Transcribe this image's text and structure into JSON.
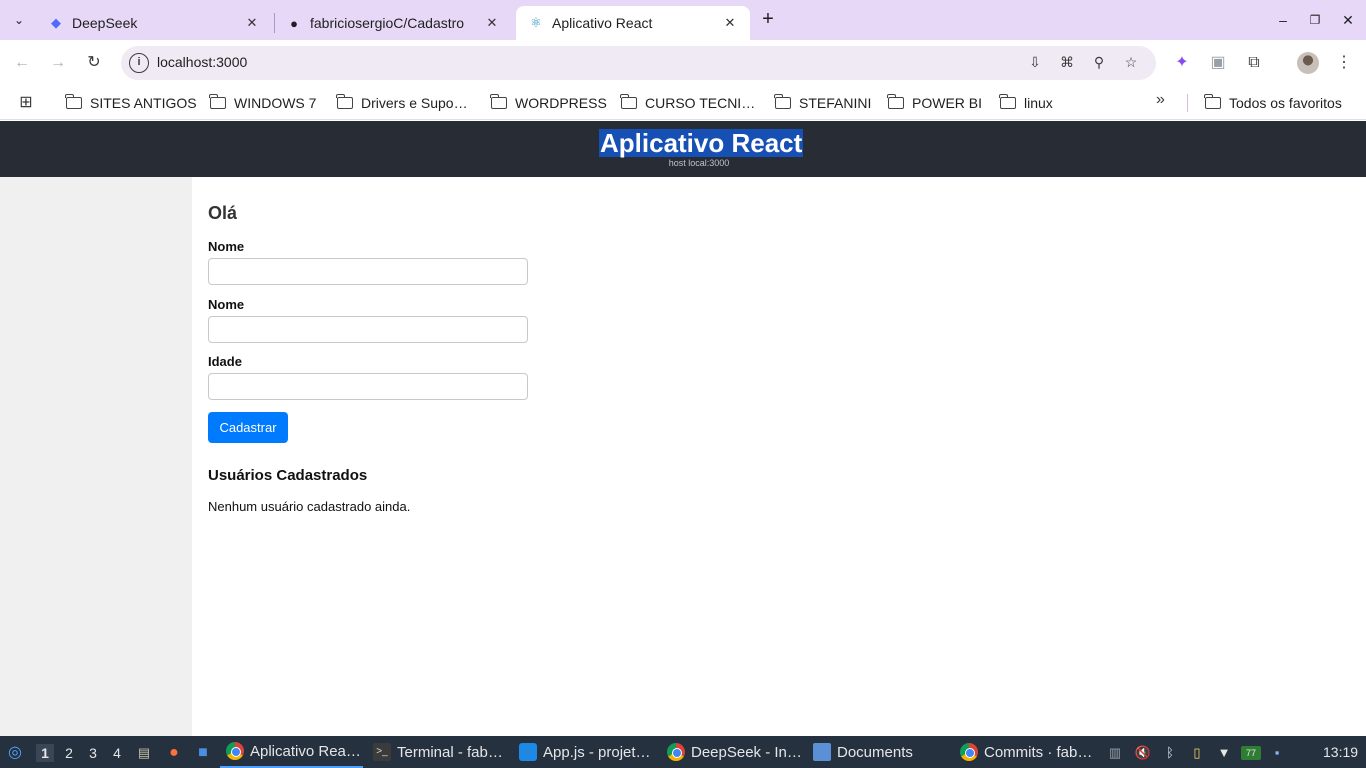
{
  "browser": {
    "tabs": [
      {
        "title": "DeepSeek",
        "favicon": "deepseek-whale-icon"
      },
      {
        "title": "fabriciosergioC/Cadastro",
        "favicon": "github-icon"
      },
      {
        "title": "Aplicativo React",
        "favicon": "react-icon",
        "active": true
      }
    ],
    "new_tab": "+",
    "window_controls": {
      "minimize": "–",
      "restore": "❐",
      "close": "✕"
    },
    "url": "localhost:3000",
    "bookmarks": [
      "SITES ANTIGOS",
      "WINDOWS 7",
      "Drivers e Supo…",
      "WORDPRESS",
      "CURSO TECNI…",
      "STEFANINI",
      "POWER BI",
      "linux"
    ],
    "all_bookmarks": "Todos os favoritos"
  },
  "app": {
    "title": "Aplicativo React",
    "subtitle": "host local:3000",
    "greeting": "Olá",
    "fields": [
      {
        "label": "Nome",
        "value": ""
      },
      {
        "label": "Nome",
        "value": ""
      },
      {
        "label": "Idade",
        "value": ""
      }
    ],
    "submit_label": "Cadastrar",
    "users_heading": "Usuários Cadastrados",
    "empty_message": "Nenhum usuário cadastrado ainda."
  },
  "taskbar": {
    "workspaces": [
      "1",
      "2",
      "3",
      "4"
    ],
    "active_workspace": "1",
    "windows": [
      {
        "title": "Aplicativo Rea…",
        "icon": "chrome-icon",
        "active": true
      },
      {
        "title": "Terminal - fab…",
        "icon": "terminal-icon"
      },
      {
        "title": "App.js - projet…",
        "icon": "vscode-icon"
      },
      {
        "title": "DeepSeek - In…",
        "icon": "chrome-icon"
      },
      {
        "title": "Documents",
        "icon": "folder-icon"
      },
      {
        "title": "Commits · fab…",
        "icon": "chrome-icon"
      }
    ],
    "battery": "77",
    "clock": "13:19"
  }
}
